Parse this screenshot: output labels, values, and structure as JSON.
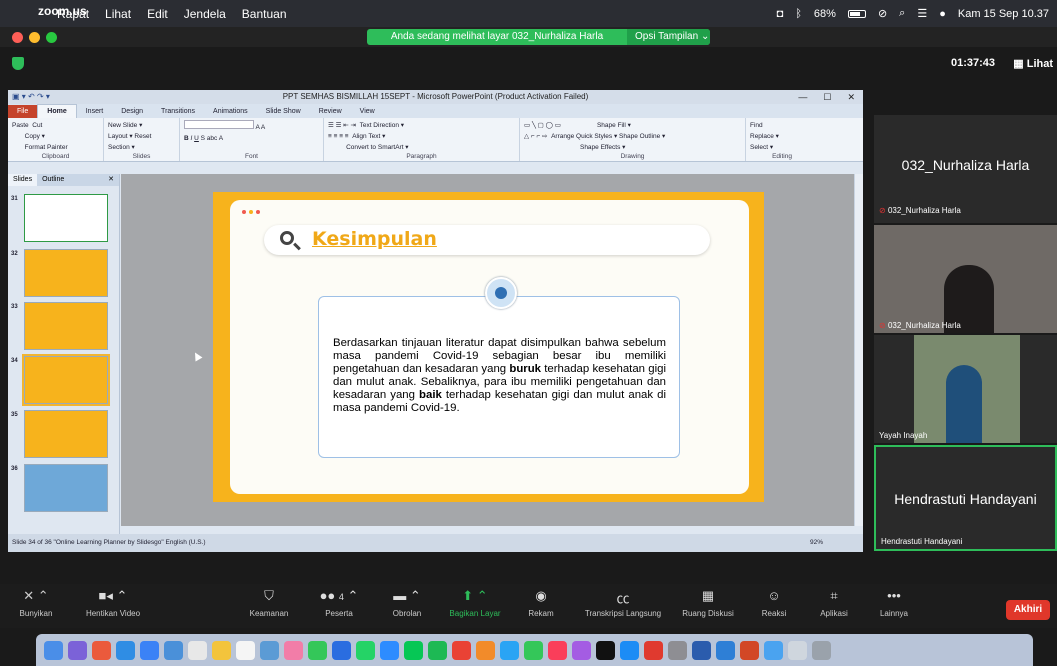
{
  "menubar": {
    "app": "zoom.us",
    "items": [
      "Rapat",
      "Lihat",
      "Edit",
      "Jendela",
      "Bantuan"
    ],
    "battery": "68%",
    "datetime": "Kam 15 Sep  10.37"
  },
  "share_banner": {
    "text": "Anda sedang melihat layar 032_Nurhaliza Harla",
    "options": "Opsi Tampilan ⌄"
  },
  "meeting": {
    "timer": "01:37:43",
    "view_label": "Lihat"
  },
  "ppt": {
    "title": "PPT SEMHAS BISMILLAH 15SEPT  -  Microsoft PowerPoint (Product Activation Failed)",
    "tabs": [
      "File",
      "Home",
      "Insert",
      "Design",
      "Transitions",
      "Animations",
      "Slide Show",
      "Review",
      "View"
    ],
    "ribbon": {
      "clipboard": {
        "paste": "Paste",
        "cut": "Cut",
        "copy": "Copy ▾",
        "format_painter": "Format Painter",
        "name": "Clipboard"
      },
      "slides": {
        "new_slide": "New Slide ▾",
        "layout": "Layout ▾",
        "reset": "Reset",
        "section": "Section ▾",
        "name": "Slides"
      },
      "font": {
        "name": "Font"
      },
      "paragraph": {
        "text_direction": "Text Direction ▾",
        "align_text": "Align Text ▾",
        "smartart": "Convert to SmartArt ▾",
        "name": "Paragraph"
      },
      "drawing": {
        "arrange": "Arrange",
        "quick_styles": "Quick Styles ▾",
        "shape_fill": "Shape Fill ▾",
        "shape_outline": "Shape Outline ▾",
        "shape_effects": "Shape Effects ▾",
        "name": "Drawing"
      },
      "editing": {
        "find": "Find",
        "replace": "Replace ▾",
        "select": "Select ▾",
        "name": "Editing"
      }
    },
    "pane_tabs": [
      "Slides",
      "Outline"
    ],
    "thumbnails": [
      "31",
      "32",
      "33",
      "34",
      "35",
      "36"
    ],
    "slide": {
      "title": "Kesimpulan",
      "body_1": "Berdasarkan tinjauan literatur dapat disimpulkan bahwa sebelum masa pandemi Covid-19 sebagian besar ibu memiliki pengetahuan dan kesadaran yang ",
      "body_bold_1": "buruk",
      "body_2": " terhadap kesehatan gigi dan mulut anak. Sebaliknya, para ibu memiliki pengetahuan dan kesadaran yang ",
      "body_bold_2": "baik",
      "body_3": " terhadap kesehatan gigi dan mulut anak di masa pandemi Covid-19."
    },
    "status": {
      "left": "Slide 34 of 36   \"Online Learning Planner by Slidesgo\"   English (U.S.)",
      "zoom": "92%"
    }
  },
  "participants": [
    {
      "big_name": "032_Nurhaliza Harla",
      "label": "032_Nurhaliza Harla"
    },
    {
      "label": "032_Nurhaliza Harla"
    },
    {
      "label": "Yayah Inayah"
    },
    {
      "big_name": "Hendrastuti Handayani",
      "label": "Hendrastuti Handayani"
    }
  ],
  "toolbar": {
    "unmute": "Bunyikan",
    "stop_video": "Hentikan Video",
    "security": "Keamanan",
    "participants": "Peserta",
    "participants_count": "4",
    "chat": "Obrolan",
    "share": "Bagikan Layar",
    "record": "Rekam",
    "transcript": "Transkripsi Langsung",
    "rooms": "Ruang Diskusi",
    "reactions": "Reaksi",
    "apps": "Aplikasi",
    "more": "Lainnya",
    "end": "Akhiri"
  },
  "colors": {
    "zoom_green": "#2ebd5a",
    "slide_orange": "#f7b31c",
    "end_red": "#e0372a"
  }
}
